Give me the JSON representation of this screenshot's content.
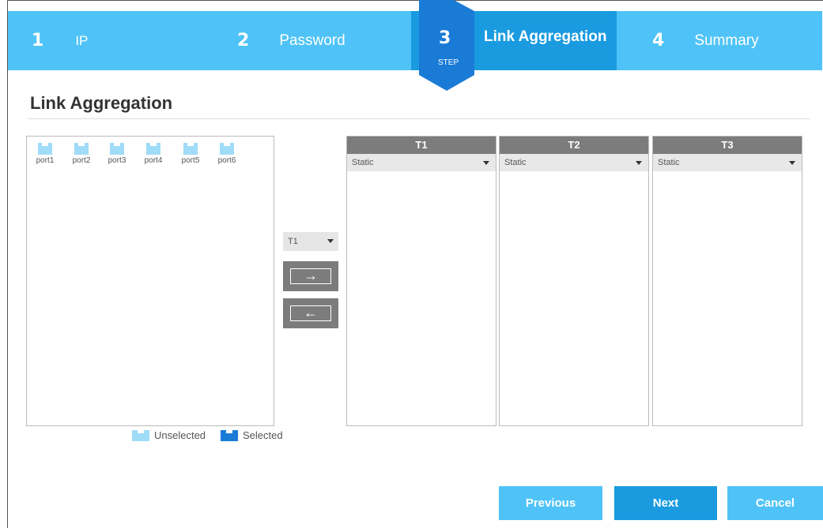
{
  "wizard": {
    "steps": [
      {
        "num": "1",
        "label": "IP"
      },
      {
        "num": "2",
        "label": "Password"
      },
      {
        "num": "3",
        "label": "Link Aggregation",
        "sub": "STEP"
      },
      {
        "num": "4",
        "label": "Summary"
      }
    ],
    "active_step": 3
  },
  "page_title": "Link Aggregation",
  "ports": [
    "port1",
    "port2",
    "port3",
    "port4",
    "port5",
    "port6"
  ],
  "legend": {
    "unselected": "Unselected",
    "selected": "Selected"
  },
  "trunk_select": {
    "value": "T1"
  },
  "trunks": [
    {
      "name": "T1",
      "mode": "Static"
    },
    {
      "name": "T2",
      "mode": "Static"
    },
    {
      "name": "T3",
      "mode": "Static"
    }
  ],
  "move_buttons": {
    "add": "→",
    "remove": "←"
  },
  "buttons": {
    "previous": "Previous",
    "next": "Next",
    "cancel": "Cancel"
  },
  "colors": {
    "step_bar": "#4fc3f7",
    "active_step": "#1a9be0",
    "port_unselected": "#9fdcf8",
    "port_selected": "#1a7bd6",
    "trunk_header": "#7c7c7c"
  }
}
